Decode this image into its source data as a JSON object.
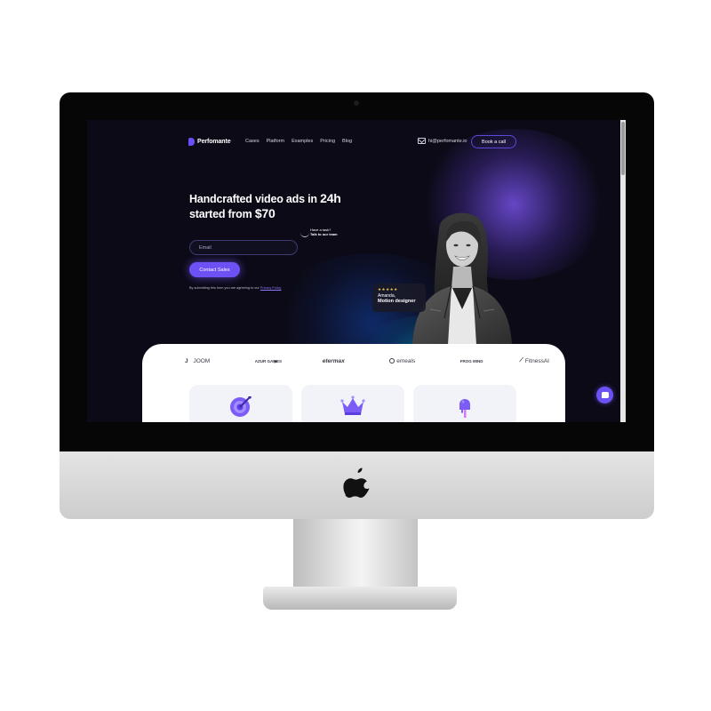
{
  "nav": {
    "logo_text": "Perfomante",
    "links": [
      "Cases",
      "Platform",
      "Examples",
      "Pricing",
      "Blog"
    ],
    "email": "hi@perfomante.io",
    "book_label": "Book a call"
  },
  "hero": {
    "title_line1_prefix": "Handcrafted video ads in ",
    "title_line1_highlight": "24h",
    "title_line2_prefix": "started from ",
    "title_line2_highlight": "$70",
    "email_placeholder": "Email",
    "hint_line1": "Have a task?",
    "hint_line2": "Talk to our team",
    "contact_label": "Contact Sales",
    "disclaimer": "By submitting this form you are agreeing to our ",
    "policy_link": "Privacy Policy"
  },
  "badge": {
    "stars": "★★★★★",
    "name": "Amanda,",
    "role": "Motion designer"
  },
  "clients": [
    "JOOM",
    "AZUR GAMES",
    "etermax",
    "emeals",
    "FROG MIND",
    "FitnessAI"
  ],
  "features": [
    {
      "icon": "target-icon"
    },
    {
      "icon": "crown-icon"
    },
    {
      "icon": "popsicle-icon"
    }
  ],
  "colors": {
    "accent": "#6d51f5",
    "background": "#0b0a16",
    "card": "#ffffff",
    "star": "#f2c94c"
  }
}
